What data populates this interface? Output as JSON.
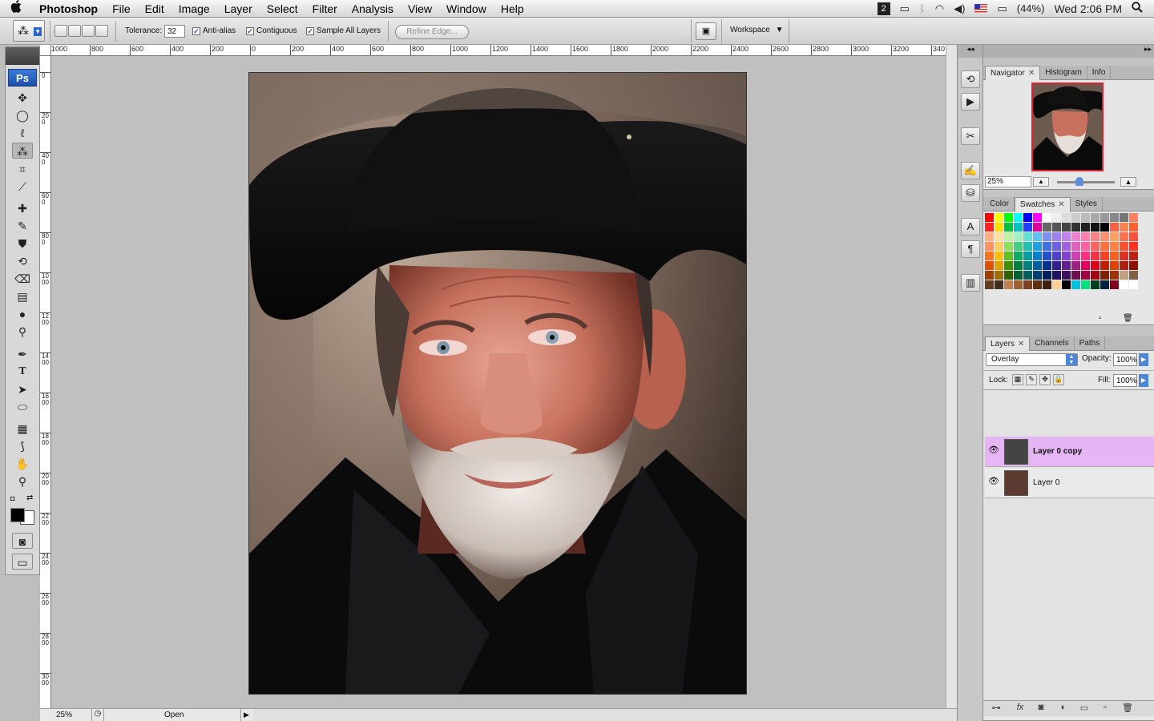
{
  "menubar": {
    "apple": "",
    "app_name": "Photoshop",
    "menus": [
      "File",
      "Edit",
      "Image",
      "Layer",
      "Select",
      "Filter",
      "Analysis",
      "View",
      "Window",
      "Help"
    ],
    "battery": "(44%)",
    "clock": "Wed 2:06 PM"
  },
  "options": {
    "tolerance_label": "Tolerance:",
    "tolerance_value": "32",
    "anti_alias": "Anti-alias",
    "contiguous": "Contiguous",
    "sample_all_layers": "Sample All Layers",
    "refine_edge": "Refine Edge...",
    "workspace": "Workspace"
  },
  "toolbox": {
    "logo": "Ps"
  },
  "rulers": {
    "top": [
      "1000",
      "800",
      "600",
      "400",
      "200",
      "0",
      "200",
      "400",
      "600",
      "800",
      "1000",
      "1200",
      "1400",
      "1600",
      "1800",
      "2000",
      "2200",
      "2400",
      "2600",
      "2800",
      "3000",
      "3200",
      "340"
    ],
    "left": [
      "0",
      "200",
      "400",
      "600",
      "800",
      "1000",
      "1200",
      "1400",
      "1600",
      "1800",
      "2000",
      "2200",
      "2400",
      "2600",
      "2800",
      "3000"
    ]
  },
  "status": {
    "zoom": "25%",
    "doc_info": "Open"
  },
  "navigator": {
    "tabs": [
      "Navigator",
      "Histogram",
      "Info"
    ],
    "zoom": "25%",
    "zoom_level": 0.25
  },
  "swatches": {
    "tabs": [
      "Color",
      "Swatches",
      "Styles"
    ],
    "colors": [
      "#ff0000",
      "#ffff00",
      "#00ff00",
      "#00ffff",
      "#0000ff",
      "#ff00ff",
      "#ffffff",
      "#eeeeee",
      "#dddddd",
      "#cccccc",
      "#bbbbbb",
      "#aaaaaa",
      "#999999",
      "#888888",
      "#777777",
      "#ff8060",
      "#ff2020",
      "#ffe000",
      "#00c040",
      "#00c0c0",
      "#2040ff",
      "#e000a0",
      "#666666",
      "#555555",
      "#444444",
      "#333333",
      "#222222",
      "#111111",
      "#000000",
      "#ff6040",
      "#ff8050",
      "#ff6030",
      "#ffb080",
      "#ffe0a0",
      "#c0f0a0",
      "#a0f0c0",
      "#60e0d0",
      "#60c0f0",
      "#8090f0",
      "#a080f0",
      "#c080f0",
      "#f080d0",
      "#ff80b0",
      "#ff8080",
      "#ff9070",
      "#ffa060",
      "#ff7050",
      "#ff5040",
      "#ff9060",
      "#ffd060",
      "#90e060",
      "#40d080",
      "#20c0b0",
      "#20a0e0",
      "#4070e0",
      "#7060e0",
      "#a060e0",
      "#e060c0",
      "#ff60a0",
      "#ff6060",
      "#ff7040",
      "#ff8040",
      "#ff5030",
      "#ff3020",
      "#ff7020",
      "#ffc000",
      "#60c020",
      "#00b060",
      "#00a0a0",
      "#0080d0",
      "#2050d0",
      "#5040d0",
      "#8040d0",
      "#d040b0",
      "#ff3080",
      "#ff3040",
      "#ff4020",
      "#ff6020",
      "#e03020",
      "#c02010",
      "#e05000",
      "#e0a000",
      "#409000",
      "#008040",
      "#008080",
      "#0060a0",
      "#003090",
      "#302090",
      "#602090",
      "#a02080",
      "#e00060",
      "#e00020",
      "#c02000",
      "#e04000",
      "#b02010",
      "#901000",
      "#a04000",
      "#a07000",
      "#306000",
      "#006030",
      "#006060",
      "#004070",
      "#002060",
      "#201060",
      "#401060",
      "#701050",
      "#a00040",
      "#a00010",
      "#802000",
      "#a03000",
      "#c0a080",
      "#806040",
      "#604020",
      "#403020",
      "#c08050",
      "#a06030",
      "#804020",
      "#603010",
      "#402010",
      "#ffd090",
      "#000000",
      "#00c0e0",
      "#00e080",
      "#004020",
      "#002040",
      "#800020",
      "#ffffff",
      "#ffffff"
    ]
  },
  "layers": {
    "tabs": [
      "Layers",
      "Channels",
      "Paths"
    ],
    "blend_mode": "Overlay",
    "opacity_label": "Opacity:",
    "opacity": "100%",
    "lock_label": "Lock:",
    "fill_label": "Fill:",
    "fill": "100%",
    "items": [
      {
        "name": "Layer 0 copy",
        "selected": true
      },
      {
        "name": "Layer 0",
        "selected": false
      }
    ]
  }
}
